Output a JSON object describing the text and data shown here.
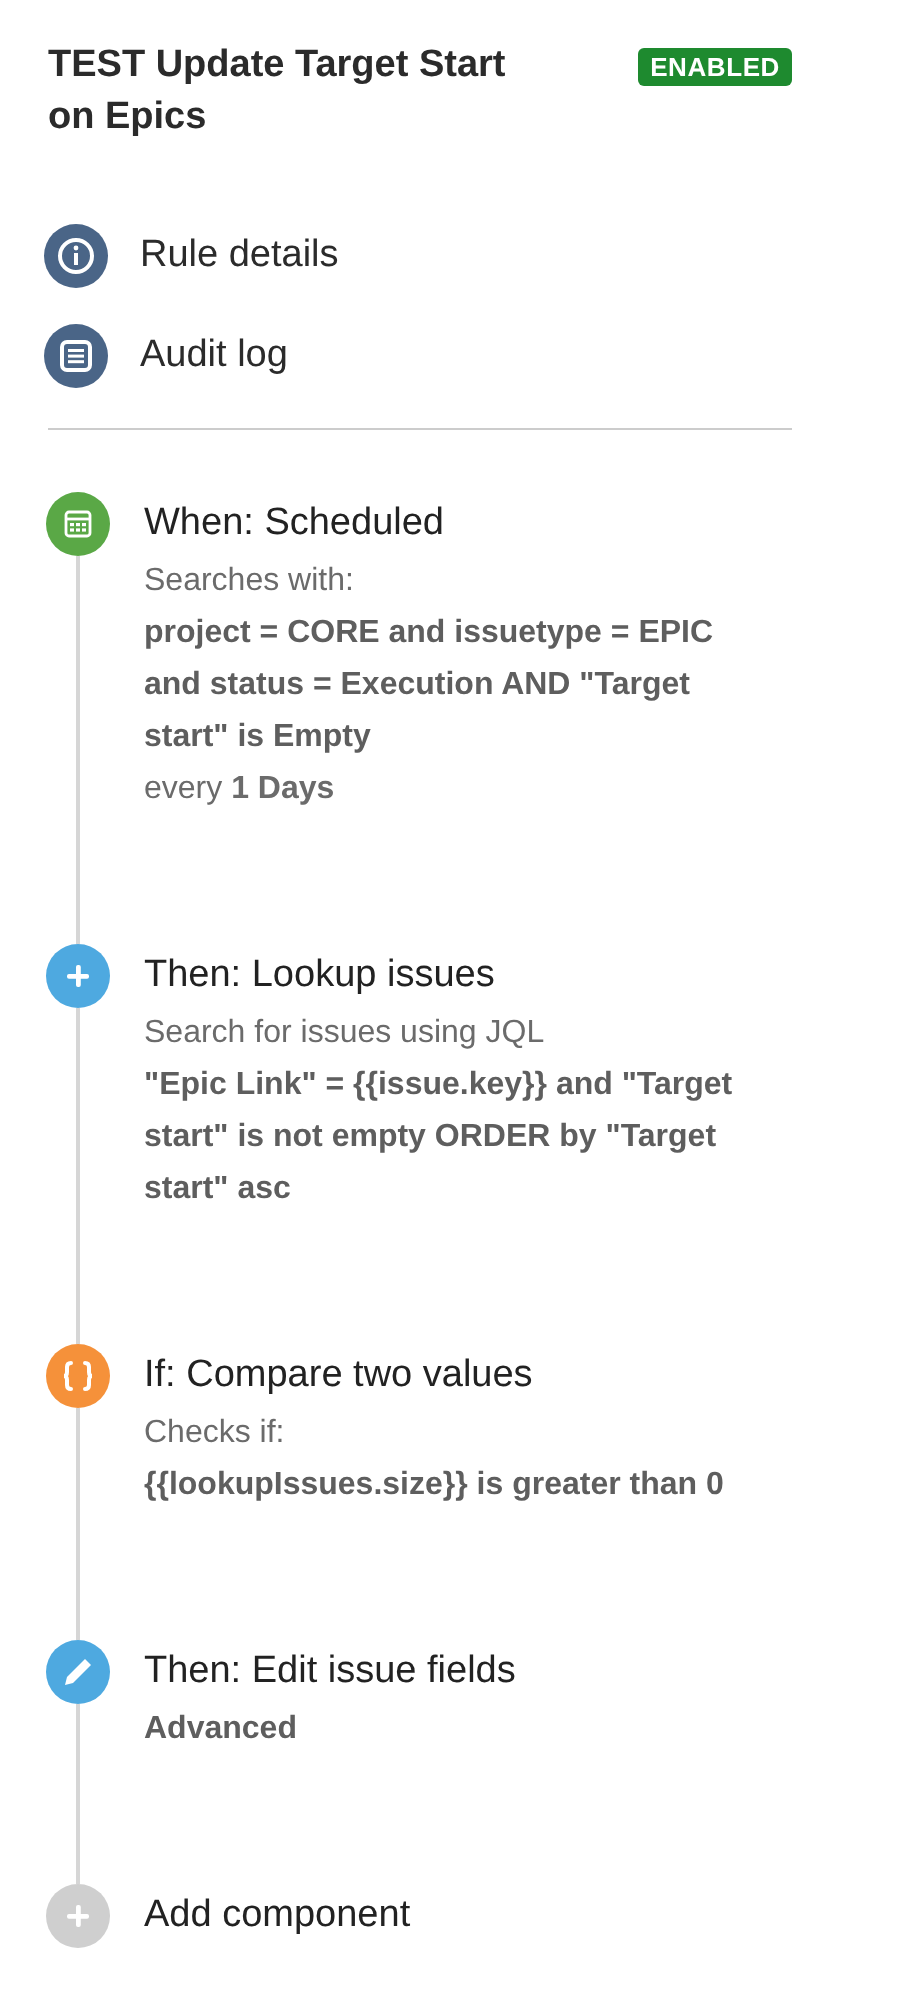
{
  "rule": {
    "title": "TEST Update Target Start on Epics",
    "status": "ENABLED"
  },
  "nav": [
    {
      "label": "Rule details",
      "kind": "info"
    },
    {
      "label": "Audit log",
      "kind": "log"
    }
  ],
  "steps": [
    {
      "kind": "trigger",
      "title": "When: Scheduled",
      "details": [
        {
          "text": "Searches with:",
          "strong": false
        },
        {
          "text": "project = CORE and issuetype = EPIC and status = Execution AND \"Target start\" is Empty",
          "strong": true
        },
        {
          "text": "every **1 Days**",
          "strong": false
        }
      ]
    },
    {
      "kind": "lookup",
      "title": "Then: Lookup issues",
      "details": [
        {
          "text": "Search for issues using JQL",
          "strong": false
        },
        {
          "text": "\"Epic Link\" = {{issue.key}} and \"Target start\" is not empty ORDER by \"Target start\" asc",
          "strong": true
        }
      ]
    },
    {
      "kind": "condition",
      "title": "If: Compare two values",
      "details": [
        {
          "text": "Checks if:",
          "strong": false
        },
        {
          "text": "{{lookupIssues.size}} is greater than 0",
          "strong": true
        }
      ]
    },
    {
      "kind": "edit",
      "title": "Then: Edit issue fields",
      "details": [
        {
          "text": "Advanced",
          "strong": true
        }
      ]
    },
    {
      "kind": "add",
      "title": "Add component"
    }
  ]
}
